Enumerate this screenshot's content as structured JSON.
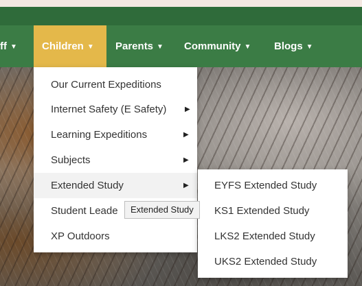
{
  "nav": {
    "items": [
      {
        "label": "ff"
      },
      {
        "label": "Children"
      },
      {
        "label": "Parents"
      },
      {
        "label": "Community"
      },
      {
        "label": "Blogs"
      }
    ],
    "caret": "▼"
  },
  "dropdown": {
    "items": [
      {
        "label": "Our Current Expeditions"
      },
      {
        "label": "Internet Safety (E Safety)"
      },
      {
        "label": "Learning Expeditions"
      },
      {
        "label": "Subjects"
      },
      {
        "label": "Extended Study"
      },
      {
        "label": "Student Leade"
      },
      {
        "label": "XP Outdoors"
      }
    ],
    "arrow": "▶"
  },
  "submenu": {
    "items": [
      {
        "label": "EYFS Extended Study"
      },
      {
        "label": "KS1 Extended Study"
      },
      {
        "label": "LKS2 Extended Study"
      },
      {
        "label": "UKS2 Extended Study"
      }
    ]
  },
  "tooltip": {
    "text": "Extended Study"
  },
  "colors": {
    "nav": "#3b7c45",
    "top_strip": "#2f6b3a",
    "active": "#e4b84a"
  }
}
